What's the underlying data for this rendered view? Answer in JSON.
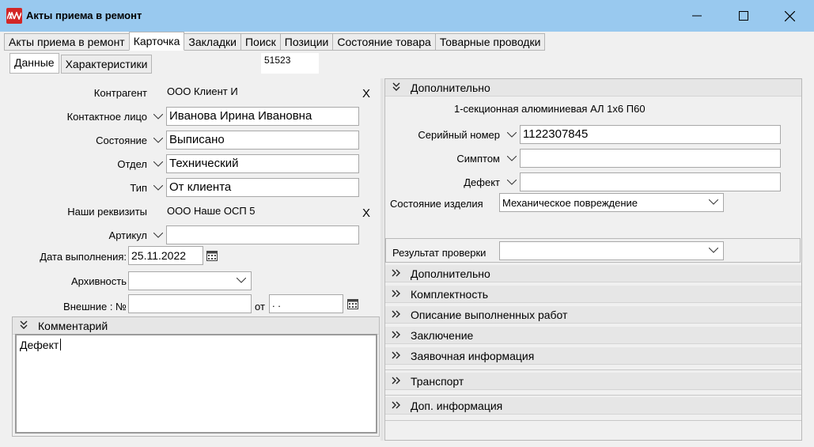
{
  "window": {
    "title": "Акты приема в ремонт",
    "minimize_icon": "minimize-icon",
    "maximize_icon": "maximize-icon",
    "close_icon": "close-icon"
  },
  "tabs": [
    {
      "label": "Акты приема в ремонт",
      "active": false
    },
    {
      "label": "Карточка",
      "active": true
    },
    {
      "label": "Закладки",
      "active": false
    },
    {
      "label": "Поиск",
      "active": false
    },
    {
      "label": "Позиции",
      "active": false
    },
    {
      "label": "Состояние товара",
      "active": false
    },
    {
      "label": "Товарные проводки",
      "active": false
    }
  ],
  "subtabs": [
    {
      "label": "Данные",
      "active": true
    },
    {
      "label": "Характеристики",
      "active": false
    }
  ],
  "record_number": "51523",
  "form": {
    "counterparty": {
      "label": "Контрагент",
      "value": "ООО Клиент И",
      "clear": "X"
    },
    "contact": {
      "label": "Контактное лицо",
      "value": "Иванова Ирина Ивановна"
    },
    "state": {
      "label": "Состояние",
      "value": "Выписано"
    },
    "department": {
      "label": "Отдел",
      "value": "Технический"
    },
    "type": {
      "label": "Тип",
      "value": "От клиента"
    },
    "our_details": {
      "label": "Наши реквизиты",
      "value": "ООО Наше ОСП 5",
      "clear": "X"
    },
    "article": {
      "label": "Артикул",
      "value": ""
    },
    "due_date": {
      "label": "Дата выполнения:",
      "value": "25.11.2022"
    },
    "archive": {
      "label": "Архивность",
      "value": ""
    },
    "external_no": {
      "label": "Внешние : №",
      "value": "",
      "from_label": "от",
      "date_value": " .  . "
    }
  },
  "comment": {
    "header": "Комментарий",
    "text": "Дефект"
  },
  "right_panel": {
    "header": "Дополнительно",
    "product_name": "1-секционная алюминиевая АЛ 1х6 П60",
    "serial": {
      "label": "Серийный номер",
      "value": "1122307845"
    },
    "symptom": {
      "label": "Симптом",
      "value": ""
    },
    "defect": {
      "label": "Дефект",
      "value": ""
    },
    "product_state": {
      "label": "Состояние изделия",
      "value": "Механическое повреждение"
    },
    "check_result": {
      "label": "Результат проверки",
      "value": ""
    },
    "sections": [
      "Дополнительно",
      "Комплектность",
      "Описание выполненных работ",
      "Заключение",
      "Заявочная информация",
      "Транспорт",
      "Доп. информация"
    ]
  }
}
